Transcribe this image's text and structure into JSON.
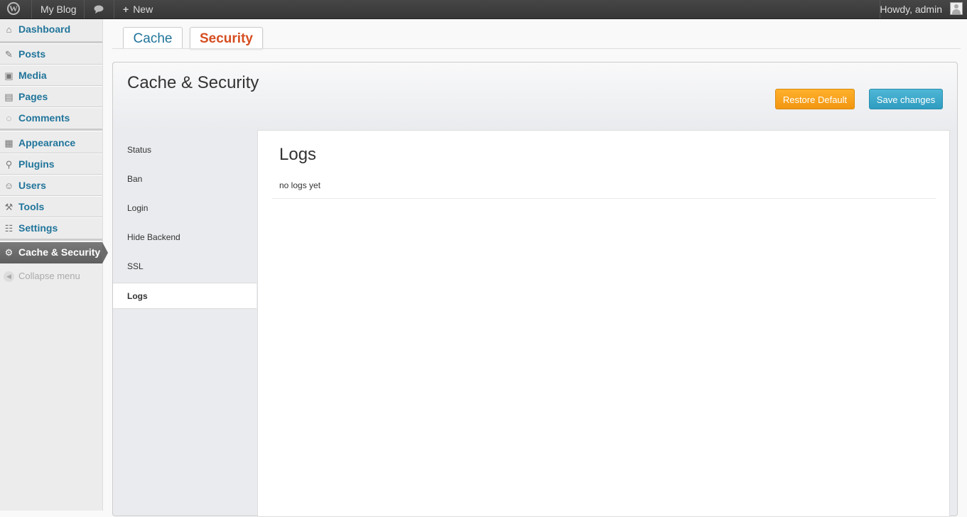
{
  "adminbar": {
    "site_name": "My Blog",
    "new_label": "New",
    "howdy": "Howdy, admin"
  },
  "sidebar": {
    "items": [
      {
        "label": "Dashboard",
        "icon": "dashboard-icon"
      },
      {
        "label": "Posts",
        "icon": "pin-icon"
      },
      {
        "label": "Media",
        "icon": "media-icon"
      },
      {
        "label": "Pages",
        "icon": "pages-icon"
      },
      {
        "label": "Comments",
        "icon": "comments-icon"
      },
      {
        "label": "Appearance",
        "icon": "appearance-icon"
      },
      {
        "label": "Plugins",
        "icon": "plugins-icon"
      },
      {
        "label": "Users",
        "icon": "users-icon"
      },
      {
        "label": "Tools",
        "icon": "tools-icon"
      },
      {
        "label": "Settings",
        "icon": "settings-icon"
      },
      {
        "label": "Cache & Security",
        "icon": "gear-icon"
      }
    ],
    "collapse_label": "Collapse menu"
  },
  "tabs": [
    {
      "label": "Cache"
    },
    {
      "label": "Security",
      "active": true
    }
  ],
  "panel": {
    "title": "Cache & Security",
    "restore_label": "Restore Default",
    "save_label": "Save changes"
  },
  "subnav": [
    {
      "label": "Status"
    },
    {
      "label": "Ban"
    },
    {
      "label": "Login"
    },
    {
      "label": "Hide Backend"
    },
    {
      "label": "SSL"
    },
    {
      "label": "Logs",
      "active": true
    }
  ],
  "content": {
    "title": "Logs",
    "text": "no logs yet"
  },
  "colors": {
    "link": "#21759b",
    "active_tab": "#d54e21",
    "restore_button": "#f29611",
    "save_button": "#2e9cc0"
  }
}
